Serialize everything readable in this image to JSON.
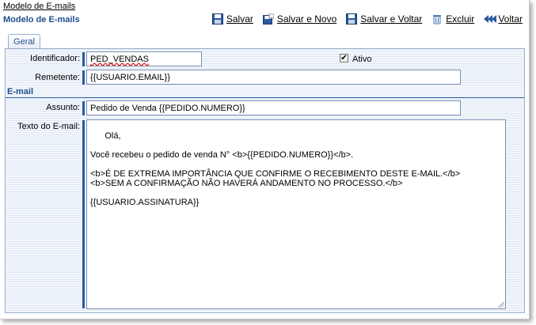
{
  "breadcrumb": "Modelo de E-mails",
  "page_title": "Modelo de E-mails",
  "toolbar": {
    "save": "Salvar",
    "save_new": "Salvar e Novo",
    "save_back": "Salvar e Voltar",
    "delete": "Excluir",
    "back": "Voltar"
  },
  "tabs": [
    {
      "label": "Geral"
    }
  ],
  "form": {
    "identificador_label": "Identificador:",
    "identificador_value": "PED_VENDAS",
    "ativo_label": "Ativo",
    "ativo_checked": "✔",
    "remetente_label": "Remetente:",
    "remetente_value": "{{USUARIO.EMAIL}}",
    "section_email": "E-mail",
    "assunto_label": "Assunto:",
    "assunto_value": "Pedido de Venda {{PEDIDO.NUMERO}}",
    "texto_label": "Texto do E-mail:",
    "texto_value": "Olá,\n\nVocê recebeu o pedido de venda N° <b>{{PEDIDO.NUMERO}}</b>.\n\n<b>É DE EXTREMA IMPORTÂNCIA QUE CONFIRME O RECEBIMENTO DESTE E-MAIL.</b>\n<b>SEM A CONFIRMAÇÃO NÃO HAVERÁ ANDAMENTO NO PROCESSO.</b>\n\n{{USUARIO.ASSINATURA}}"
  },
  "colors": {
    "accent": "#1f4e8c",
    "bar": "#2a5aa0"
  }
}
